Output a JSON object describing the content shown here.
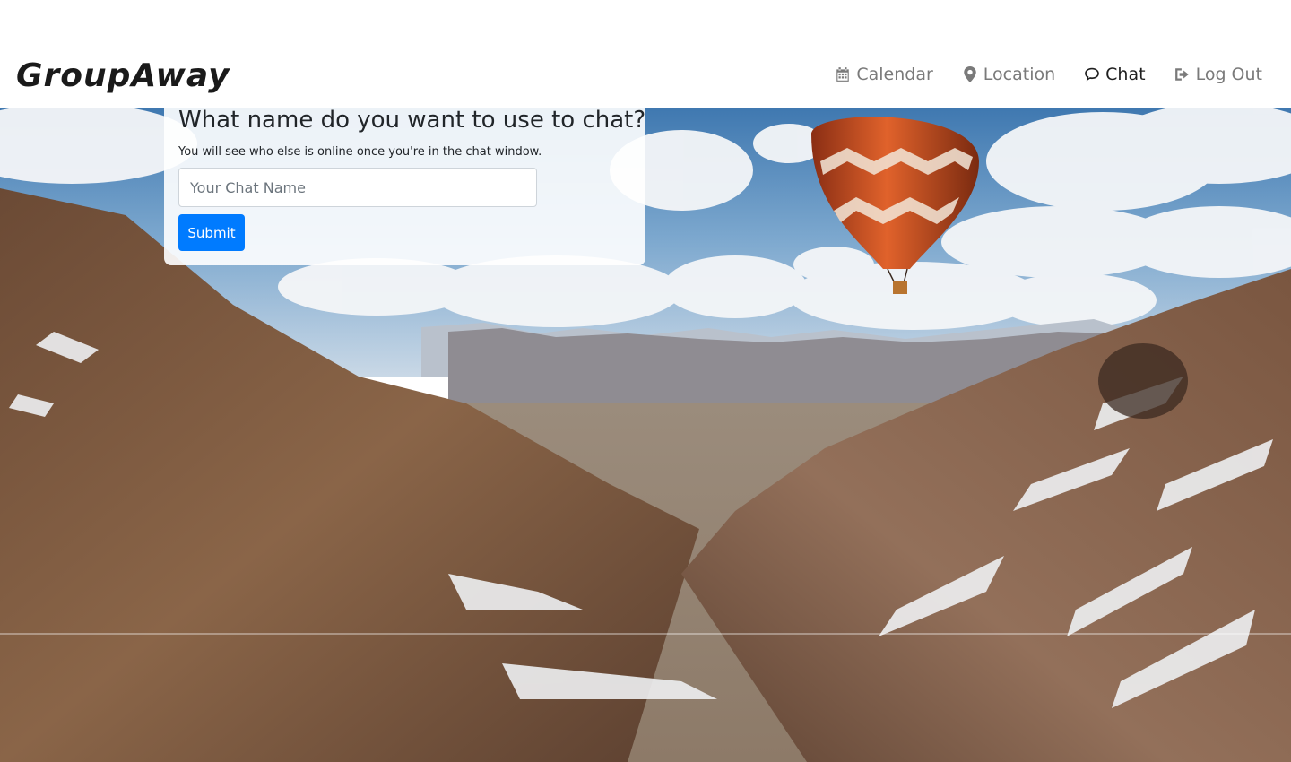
{
  "navbar": {
    "brand": "GroupAway",
    "items": [
      {
        "label": "Calendar",
        "icon": "calendar-icon",
        "active": false
      },
      {
        "label": "Location",
        "icon": "map-marker-icon",
        "active": false
      },
      {
        "label": "Chat",
        "icon": "chat-bubble-icon",
        "active": true
      },
      {
        "label": "Log Out",
        "icon": "sign-out-icon",
        "active": false
      }
    ]
  },
  "chat_form": {
    "heading": "What name do you want to use to chat?",
    "help_text": "You will see who else is online once you're in the chat window.",
    "name_input": {
      "value": "",
      "placeholder": "Your Chat Name"
    },
    "submit_label": "Submit"
  },
  "colors": {
    "primary_button": "#007bff",
    "nav_active": "#1f1f1f",
    "nav_inactive": "#7a7a7a"
  }
}
